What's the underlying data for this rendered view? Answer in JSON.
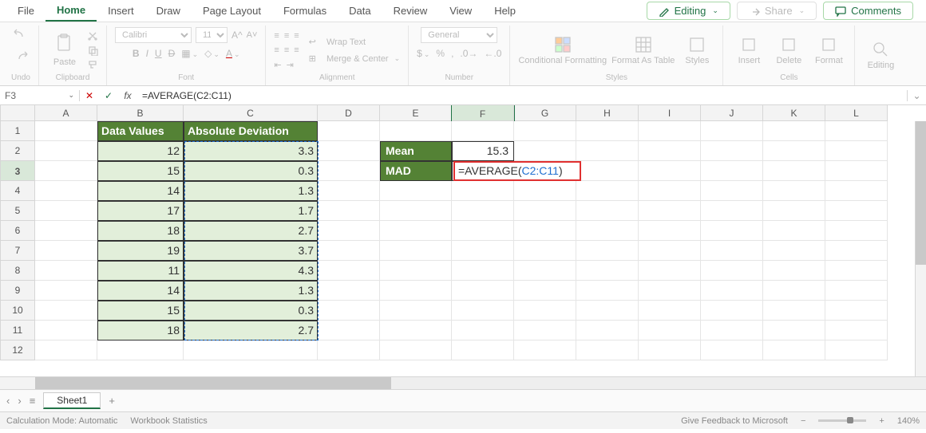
{
  "tabs": [
    "File",
    "Home",
    "Insert",
    "Draw",
    "Page Layout",
    "Formulas",
    "Data",
    "Review",
    "View",
    "Help"
  ],
  "active_tab": "Home",
  "top_buttons": {
    "editing": "Editing",
    "share": "Share",
    "comments": "Comments"
  },
  "ribbon": {
    "undo": "Undo",
    "paste": "Paste",
    "clipboard": "Clipboard",
    "font_name": "Calibri",
    "font_size": "11",
    "font_lbl": "Font",
    "wrap": "Wrap Text",
    "merge": "Merge & Center",
    "align_lbl": "Alignment",
    "num_fmt": "General",
    "num_lbl": "Number",
    "cond": "Conditional Formatting",
    "fmt_tbl": "Format As Table",
    "styles": "Styles",
    "styles_lbl": "Styles",
    "insert": "Insert",
    "delete": "Delete",
    "format": "Format",
    "cells_lbl": "Cells",
    "editing_lbl": "Editing"
  },
  "namebox": "F3",
  "formula": "=AVERAGE(C2:C11)",
  "columns": [
    "A",
    "B",
    "C",
    "D",
    "E",
    "F",
    "G",
    "H",
    "I",
    "J",
    "K",
    "L"
  ],
  "rows": [
    "1",
    "2",
    "3",
    "4",
    "5",
    "6",
    "7",
    "8",
    "9",
    "10",
    "11",
    "12"
  ],
  "headers": {
    "b": "Data Values",
    "c": "Absolute Deviation",
    "mean": "Mean",
    "mad": "MAD"
  },
  "b_vals": [
    "12",
    "15",
    "14",
    "17",
    "18",
    "19",
    "11",
    "14",
    "15",
    "18"
  ],
  "c_vals": [
    "3.3",
    "0.3",
    "1.3",
    "1.7",
    "2.7",
    "3.7",
    "4.3",
    "1.3",
    "0.3",
    "2.7"
  ],
  "mean_val": "15.3",
  "formula_display": {
    "pre": "=AVERAGE(",
    "ref": "C2:C11",
    "post": ")"
  },
  "sheet": "Sheet1",
  "status": {
    "calc": "Calculation Mode: Automatic",
    "wb": "Workbook Statistics",
    "feedback": "Give Feedback to Microsoft",
    "zoom": "140%"
  },
  "chart_data": {
    "type": "table",
    "columns": [
      "Data Values",
      "Absolute Deviation"
    ],
    "rows": [
      [
        12,
        3.3
      ],
      [
        15,
        0.3
      ],
      [
        14,
        1.3
      ],
      [
        17,
        1.7
      ],
      [
        18,
        2.7
      ],
      [
        19,
        3.7
      ],
      [
        11,
        4.3
      ],
      [
        14,
        1.3
      ],
      [
        15,
        0.3
      ],
      [
        18,
        2.7
      ]
    ],
    "mean": 15.3,
    "mad_formula": "=AVERAGE(C2:C11)"
  }
}
